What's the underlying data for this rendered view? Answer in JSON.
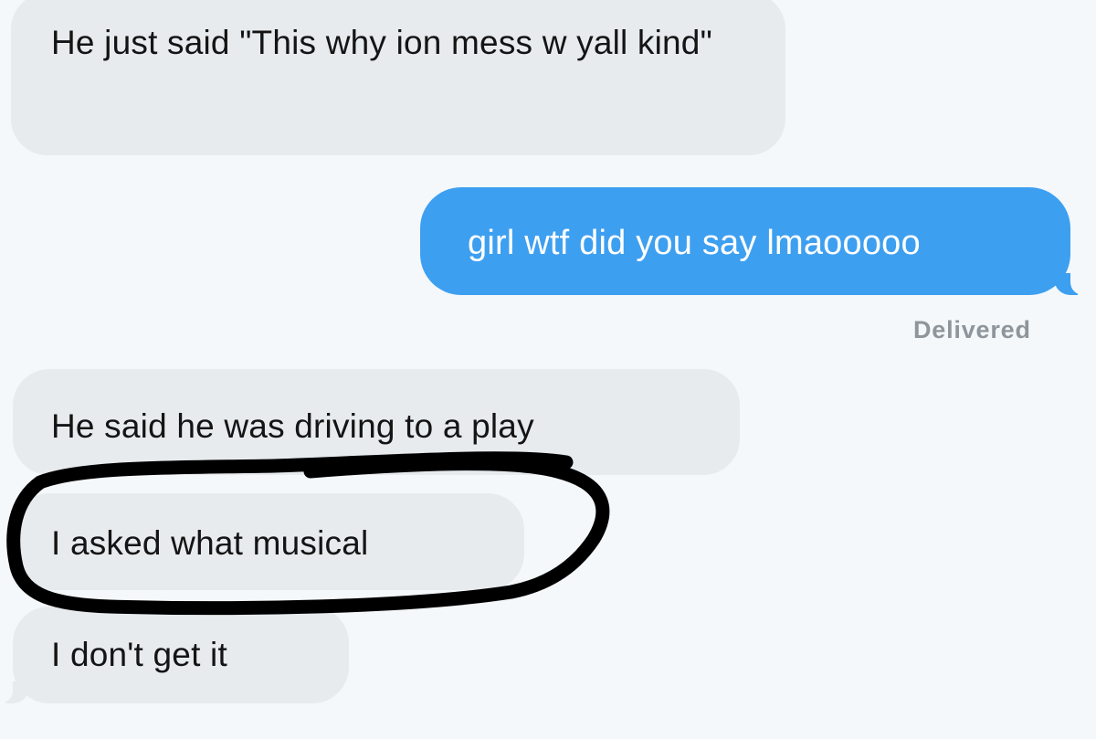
{
  "conversation": {
    "messages": [
      {
        "direction": "incoming",
        "text": "He just said \"This why ion mess w yall kind\""
      },
      {
        "direction": "outgoing",
        "text": "girl wtf did you say lmaooooo"
      },
      {
        "direction": "incoming",
        "text": "He said he was driving to a play"
      },
      {
        "direction": "incoming",
        "text": "I asked what musical"
      },
      {
        "direction": "incoming",
        "text": "I don't get it"
      }
    ],
    "delivered_label": "Delivered"
  },
  "colors": {
    "background": "#f4f8fa",
    "incoming_bubble": "#e7ebee",
    "outgoing_bubble": "#3d9ff0",
    "highlight_marker": "#000000"
  }
}
